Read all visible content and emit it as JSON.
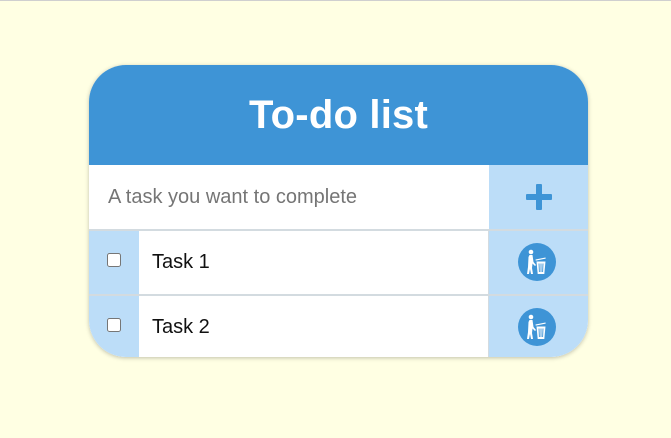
{
  "app": {
    "title": "To-do list"
  },
  "input": {
    "placeholder": "A task you want to complete",
    "value": ""
  },
  "add_button": {
    "icon": "plus-icon"
  },
  "tasks": [
    {
      "label": "Task 1",
      "checked": false,
      "delete_icon": "trash-icon"
    },
    {
      "label": "Task 2",
      "checked": false,
      "delete_icon": "trash-icon"
    }
  ],
  "colors": {
    "page_background": "#ffffe3",
    "header": "#3e94d6",
    "accent_light": "#bcddf8",
    "header_text": "#ffffff"
  }
}
